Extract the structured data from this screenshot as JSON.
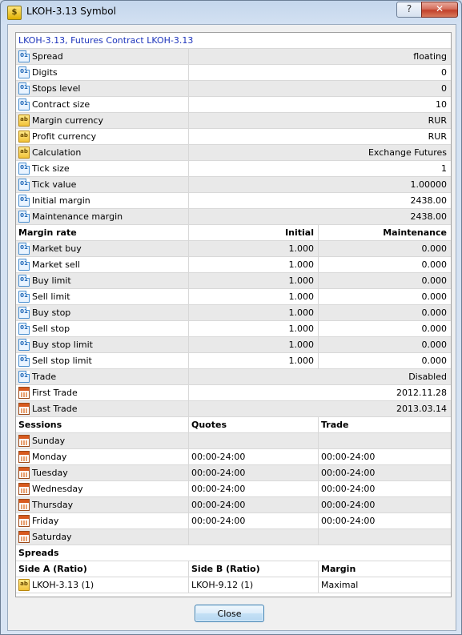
{
  "window": {
    "title": "LKOH-3.13 Symbol",
    "help_label": "?",
    "close_label": "✕"
  },
  "header": "LKOH-3.13,  Futures Contract LKOH-3.13",
  "properties": [
    {
      "label": "Spread",
      "value": "floating",
      "icon": "numeric"
    },
    {
      "label": "Digits",
      "value": "0",
      "icon": "numeric"
    },
    {
      "label": "Stops level",
      "value": "0",
      "icon": "numeric"
    },
    {
      "label": "Contract size",
      "value": "10",
      "icon": "numeric"
    },
    {
      "label": "Margin currency",
      "value": "RUR",
      "icon": "string"
    },
    {
      "label": "Profit currency",
      "value": "RUR",
      "icon": "string"
    },
    {
      "label": "Calculation",
      "value": "Exchange Futures",
      "icon": "string"
    },
    {
      "label": "Tick size",
      "value": "1",
      "icon": "numeric"
    },
    {
      "label": "Tick value",
      "value": "1.00000",
      "icon": "numeric"
    },
    {
      "label": "Initial margin",
      "value": "2438.00",
      "icon": "numeric"
    },
    {
      "label": "Maintenance margin",
      "value": "2438.00",
      "icon": "numeric"
    }
  ],
  "margin_rate": {
    "headers": [
      "Margin rate",
      "Initial",
      "Maintenance"
    ],
    "rows": [
      {
        "label": "Market buy",
        "initial": "1.000",
        "maintenance": "0.000"
      },
      {
        "label": "Market sell",
        "initial": "1.000",
        "maintenance": "0.000"
      },
      {
        "label": "Buy limit",
        "initial": "1.000",
        "maintenance": "0.000"
      },
      {
        "label": "Sell limit",
        "initial": "1.000",
        "maintenance": "0.000"
      },
      {
        "label": "Buy stop",
        "initial": "1.000",
        "maintenance": "0.000"
      },
      {
        "label": "Sell stop",
        "initial": "1.000",
        "maintenance": "0.000"
      },
      {
        "label": "Buy stop limit",
        "initial": "1.000",
        "maintenance": "0.000"
      },
      {
        "label": "Sell stop limit",
        "initial": "1.000",
        "maintenance": "0.000"
      }
    ]
  },
  "trade_info": [
    {
      "label": "Trade",
      "value": "Disabled",
      "icon": "numeric"
    },
    {
      "label": "First Trade",
      "value": "2012.11.28",
      "icon": "calendar"
    },
    {
      "label": "Last Trade",
      "value": "2013.03.14",
      "icon": "calendar"
    }
  ],
  "sessions": {
    "headers": [
      "Sessions",
      "Quotes",
      "Trade"
    ],
    "days": [
      {
        "day": "Sunday",
        "quotes": "",
        "trade": ""
      },
      {
        "day": "Monday",
        "quotes": "00:00-24:00",
        "trade": "00:00-24:00"
      },
      {
        "day": "Tuesday",
        "quotes": "00:00-24:00",
        "trade": "00:00-24:00"
      },
      {
        "day": "Wednesday",
        "quotes": "00:00-24:00",
        "trade": "00:00-24:00"
      },
      {
        "day": "Thursday",
        "quotes": "00:00-24:00",
        "trade": "00:00-24:00"
      },
      {
        "day": "Friday",
        "quotes": "00:00-24:00",
        "trade": "00:00-24:00"
      },
      {
        "day": "Saturday",
        "quotes": "",
        "trade": ""
      }
    ]
  },
  "spreads": {
    "title": "Spreads",
    "headers": [
      "Side A (Ratio)",
      "Side B (Ratio)",
      "Margin"
    ],
    "rows": [
      {
        "side_a": "LKOH-3.13 (1)",
        "side_b": "LKOH-9.12 (1)",
        "margin": "Maximal"
      }
    ]
  },
  "close_button": "Close",
  "icon_glyphs": {
    "numeric": "01",
    "string": "ab",
    "calendar": ""
  }
}
